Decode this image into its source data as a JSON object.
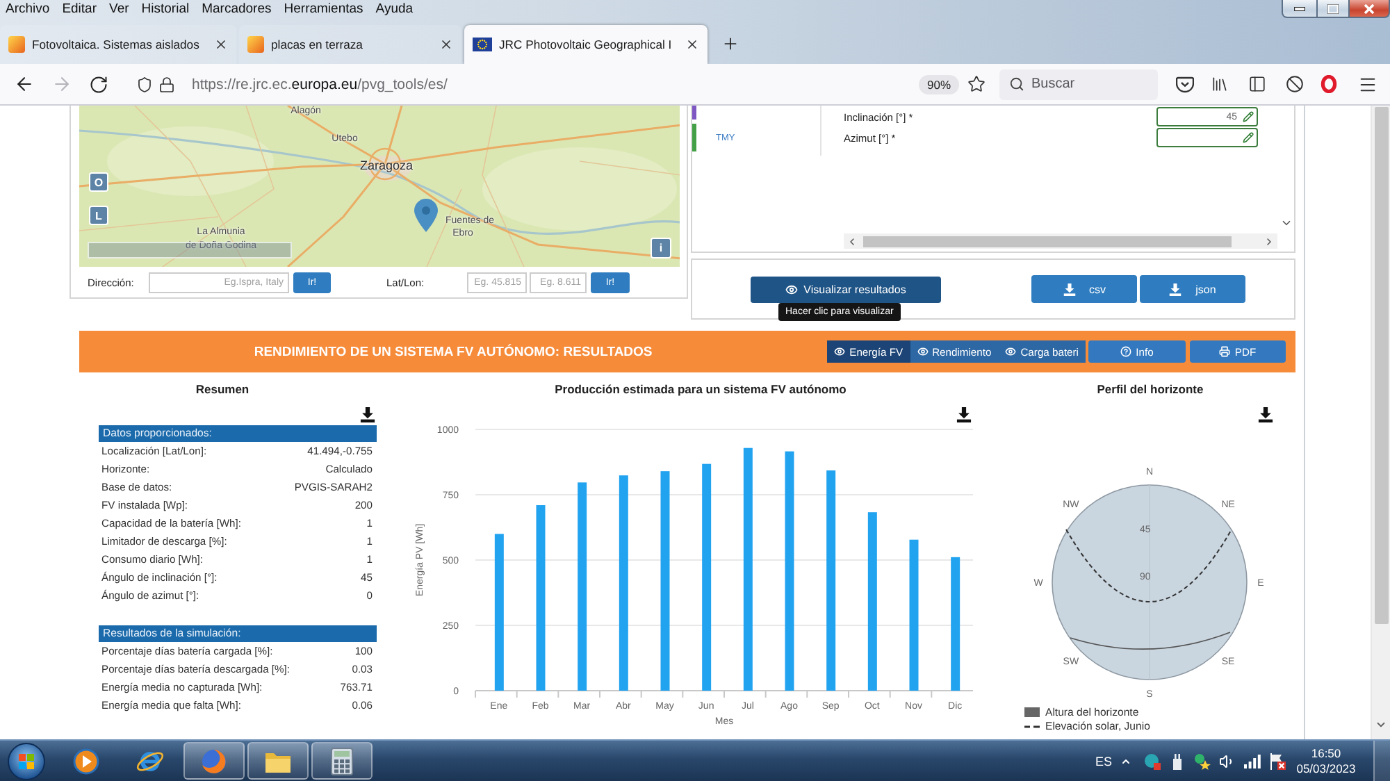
{
  "browser": {
    "menu": [
      "Archivo",
      "Editar",
      "Ver",
      "Historial",
      "Marcadores",
      "Herramientas",
      "Ayuda"
    ],
    "tabs": [
      {
        "title": "Fotovoltaica. Sistemas aislados",
        "selected": false
      },
      {
        "title": "placas en terraza",
        "selected": false
      },
      {
        "title": "JRC Photovoltaic Geographical I",
        "selected": true
      }
    ],
    "url": "https://re.jrc.ec.**europa.eu**/pvg_tools/es/",
    "zoom": "90%",
    "search": {
      "placeholder": "Buscar"
    }
  },
  "map": {
    "labels": [
      {
        "text": "Alagón",
        "kind": "town"
      },
      {
        "text": "Utebo",
        "kind": "town"
      },
      {
        "text": "Zaragoza",
        "kind": "city"
      },
      {
        "text": "La Almunia",
        "kind": "town"
      },
      {
        "text": "de Doña Godina",
        "kind": "town"
      },
      {
        "text": "Fuentes de",
        "kind": "town"
      },
      {
        "text": "Ebro",
        "kind": "town"
      }
    ],
    "layer_buttons": [
      "O",
      "L"
    ],
    "info_button": "i"
  },
  "location_search": {
    "address": {
      "label": "Dirección:",
      "placeholder": "Eg.Ispra, Italy",
      "button": "Ir!"
    },
    "latlon": {
      "label": "Lat/Lon:",
      "placeholders": [
        "Eg. 45.815",
        "Eg. 8.611"
      ],
      "button": "Ir!"
    }
  },
  "settings": {
    "side_tabs": [
      {
        "color": "#7e57c2"
      },
      {
        "label": "TMY",
        "color": "#43a047"
      }
    ],
    "fields": [
      {
        "label": "Inclinación [°] *",
        "value": "45"
      },
      {
        "label": "Azimut [°] *"
      }
    ]
  },
  "actions": {
    "visualize_button": "Visualizar resultados",
    "tooltip": "Hacer clic para visualizar",
    "downloads": [
      "csv",
      "json"
    ]
  },
  "results": {
    "title": "RENDIMIENTO DE UN SISTEMA FV AUTÓNOMO: RESULTADOS",
    "views": [
      {
        "label": "Energía FV",
        "selected": true
      },
      {
        "label": "Rendimiento",
        "selected": false
      },
      {
        "label": "Carga bateri",
        "selected": false
      }
    ],
    "buttons": [
      "Info",
      "PDF"
    ]
  },
  "summary": {
    "title": "Resumen",
    "sections": [
      {
        "title": "Datos proporcionados:",
        "rows": [
          {
            "label": "Localización [Lat/Lon]:",
            "value": "41.494,-0.755"
          },
          {
            "label": "Horizonte:",
            "value": "Calculado"
          },
          {
            "label": "Base de datos:",
            "value": "PVGIS-SARAH2"
          },
          {
            "label": "FV instalada [Wp]:",
            "value": "200"
          },
          {
            "label": "Capacidad de la batería [Wh]:",
            "value": "1"
          },
          {
            "label": "Limitador de descarga [%]:",
            "value": "1"
          },
          {
            "label": "Consumo diario [Wh]:",
            "value": "1"
          },
          {
            "label": "Ángulo de inclinación [°]:",
            "value": "45"
          },
          {
            "label": "Ángulo de azimut [°]:",
            "value": "0"
          }
        ]
      },
      {
        "title": "Resultados de la simulación:",
        "rows": [
          {
            "label": "Porcentaje días batería cargada [%]:",
            "value": "100"
          },
          {
            "label": "Porcentaje días batería descargada [%]:",
            "value": "0.03"
          },
          {
            "label": "Energía media no capturada [Wh]:",
            "value": "763.71"
          },
          {
            "label": "Energía media que falta [Wh]:",
            "value": "0.06"
          }
        ]
      }
    ]
  },
  "production": {
    "chart_data": {
      "type": "bar",
      "title": "Producción estimada para un sistema FV autónomo",
      "xlabel": "Mes",
      "ylabel": "Energía PV [Wh]",
      "categories": [
        "Ene",
        "Feb",
        "Mar",
        "Abr",
        "May",
        "Jun",
        "Jul",
        "Ago",
        "Sep",
        "Oct",
        "Nov",
        "Dic"
      ],
      "series": [
        {
          "color": "#22a3f0",
          "values": [
            600,
            710,
            797,
            824,
            840,
            868,
            929,
            916,
            843,
            683,
            578,
            511
          ]
        }
      ],
      "ylim": [
        0,
        1000
      ],
      "yticks": [
        0,
        250,
        500,
        750,
        1000
      ],
      "grid": true
    }
  },
  "horizon": {
    "title": "Perfil del horizonte",
    "compass": [
      "N",
      "NE",
      "E",
      "SE",
      "S",
      "SW",
      "W",
      "NW"
    ],
    "rings": [
      "45",
      "90"
    ],
    "legend": [
      "Altura del horizonte",
      "Elevación solar, Junio"
    ]
  },
  "taskbar": {
    "apps": [
      {
        "running": false
      },
      {
        "running": false
      },
      {
        "running": true
      },
      {
        "running": true
      },
      {
        "running": true
      }
    ],
    "language": "ES",
    "time": "16:50",
    "date": "05/03/2023"
  }
}
